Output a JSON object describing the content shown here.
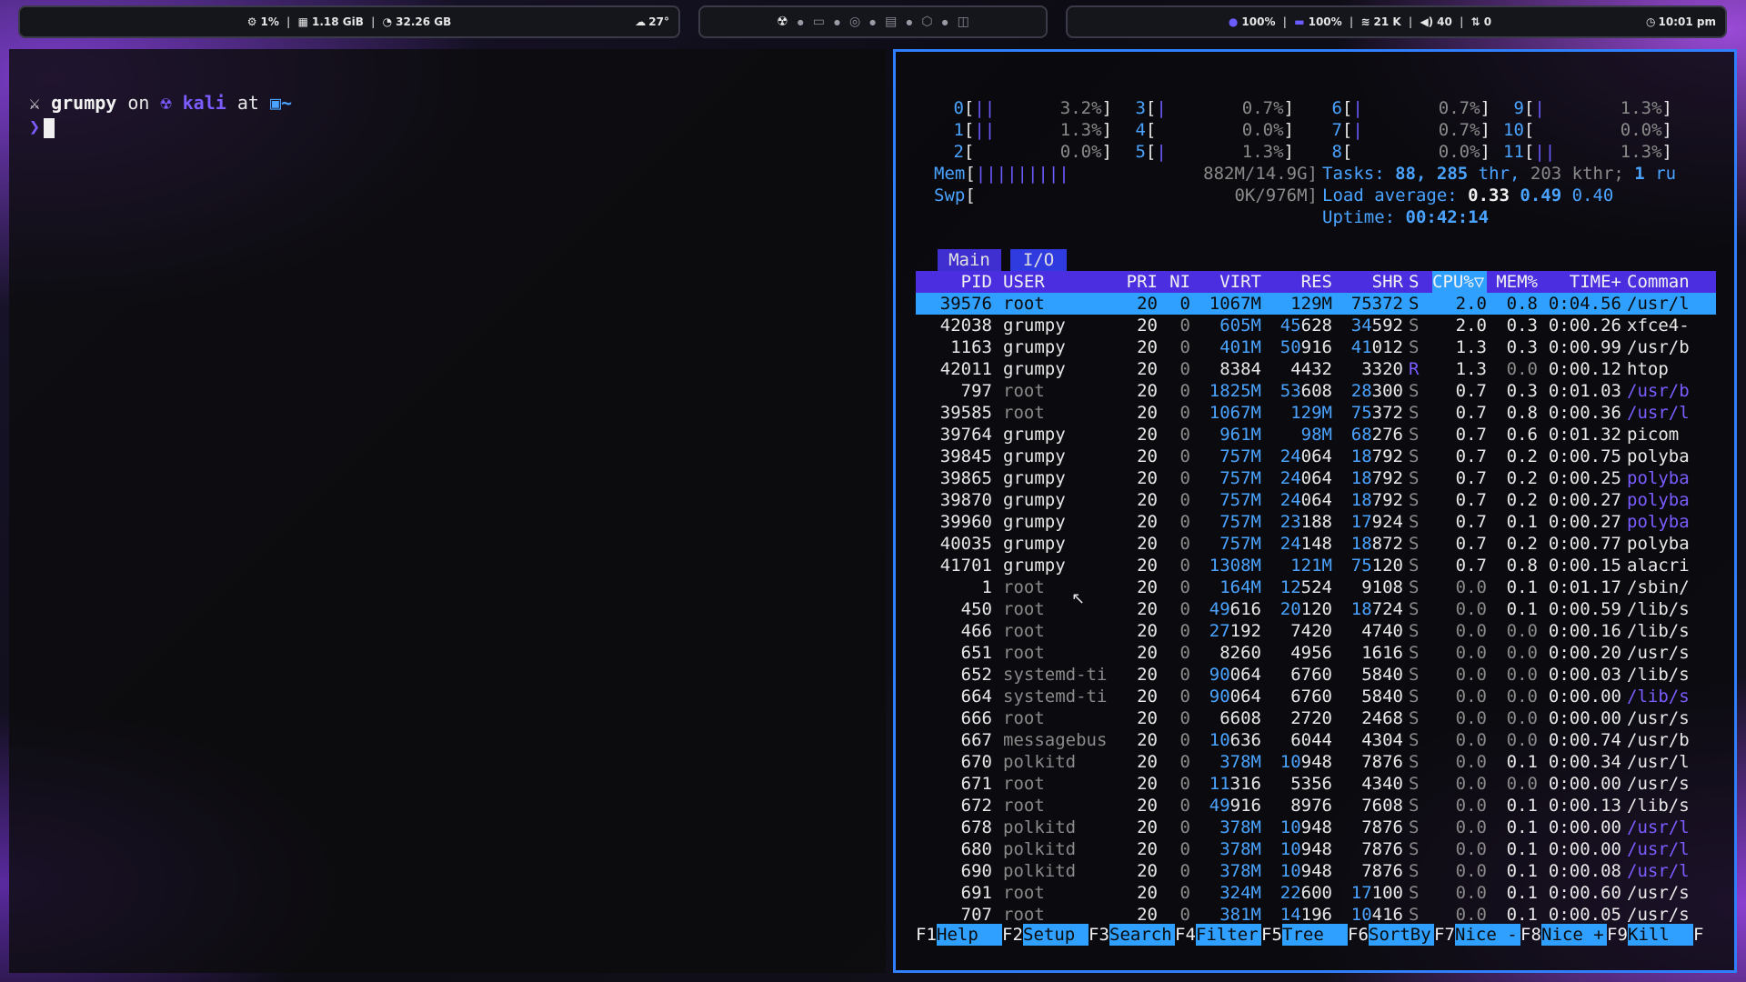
{
  "topbar": {
    "left": {
      "cpu": "1%",
      "ram": "1.18 GiB",
      "disk": "32.26 GB",
      "weather": "27°"
    },
    "workspaces": [
      "kali-icon",
      "folder-icon",
      "globe-icon",
      "chat-icon",
      "cube-icon",
      "gamepad-icon"
    ],
    "right": {
      "brightness": "100%",
      "battery": "100%",
      "network": "21 K",
      "volume": "40",
      "updates": "0",
      "clock": "10:01 pm"
    }
  },
  "left_terminal": {
    "user": "grumpy",
    "on": "on",
    "host": "kali",
    "at": "at",
    "dir": "~",
    "prompt_char": "❯"
  },
  "htop": {
    "cpus": [
      {
        "id": "0",
        "bar": "||",
        "pct": "3.2%]"
      },
      {
        "id": "1",
        "bar": "||",
        "pct": "1.3%]"
      },
      {
        "id": "2",
        "bar": "",
        "pct": "0.0%]"
      },
      {
        "id": "3",
        "bar": "|",
        "pct": "0.7%]"
      },
      {
        "id": "4",
        "bar": "",
        "pct": "0.0%]"
      },
      {
        "id": "5",
        "bar": "|",
        "pct": "1.3%]"
      },
      {
        "id": "6",
        "bar": "|",
        "pct": "0.7%]"
      },
      {
        "id": "7",
        "bar": "|",
        "pct": "0.7%]"
      },
      {
        "id": "8",
        "bar": "",
        "pct": "0.0%]"
      },
      {
        "id": "9",
        "bar": "|",
        "pct": "1.3%]"
      },
      {
        "id": "10",
        "bar": "",
        "pct": "0.0%]"
      },
      {
        "id": "11",
        "bar": "||",
        "pct": "1.3%]"
      }
    ],
    "mem": {
      "label": "Mem",
      "bar": "|||||||||",
      "value": "882M/14.9G]"
    },
    "swp": {
      "label": "Swp",
      "bar": "",
      "value": "0K/976M]"
    },
    "tasks": {
      "label": "Tasks:",
      "count": "88,",
      "thr": "285",
      "thr_label": "thr,",
      "kthr": "203 kthr;",
      "running": "1",
      "running_label": "ru"
    },
    "load": {
      "label": "Load average:",
      "one": "0.33",
      "five": "0.49",
      "fifteen": "0.40"
    },
    "uptime": {
      "label": "Uptime:",
      "value": "00:42:14"
    },
    "tabs": [
      "Main",
      "I/O"
    ],
    "columns": [
      "PID",
      "USER",
      "PRI",
      "NI",
      "VIRT",
      "RES",
      "SHR",
      "S",
      "CPU%▽",
      "MEM%",
      "TIME+",
      "Comman"
    ],
    "rows": [
      [
        "39576",
        "root",
        "20",
        "0",
        "1067M",
        "129M",
        "75372",
        "S",
        "2.0",
        "0.8",
        "0:04.56",
        "/usr/l"
      ],
      [
        "42038",
        "grumpy",
        "20",
        "0",
        "605M",
        "45628",
        "34592",
        "S",
        "2.0",
        "0.3",
        "0:00.26",
        "xfce4-"
      ],
      [
        "1163",
        "grumpy",
        "20",
        "0",
        "401M",
        "50916",
        "41012",
        "S",
        "1.3",
        "0.3",
        "0:00.99",
        "/usr/b"
      ],
      [
        "42011",
        "grumpy",
        "20",
        "0",
        "8384",
        "4432",
        "3320",
        "R",
        "1.3",
        "0.0",
        "0:00.12",
        "htop"
      ],
      [
        "797",
        "root",
        "20",
        "0",
        "1825M",
        "53608",
        "28300",
        "S",
        "0.7",
        "0.3",
        "0:01.03",
        "/usr/b"
      ],
      [
        "39585",
        "root",
        "20",
        "0",
        "1067M",
        "129M",
        "75372",
        "S",
        "0.7",
        "0.8",
        "0:00.36",
        "/usr/l"
      ],
      [
        "39764",
        "grumpy",
        "20",
        "0",
        "961M",
        "98M",
        "68276",
        "S",
        "0.7",
        "0.6",
        "0:01.32",
        "picom"
      ],
      [
        "39845",
        "grumpy",
        "20",
        "0",
        "757M",
        "24064",
        "18792",
        "S",
        "0.7",
        "0.2",
        "0:00.75",
        "polyba"
      ],
      [
        "39865",
        "grumpy",
        "20",
        "0",
        "757M",
        "24064",
        "18792",
        "S",
        "0.7",
        "0.2",
        "0:00.25",
        "polyba"
      ],
      [
        "39870",
        "grumpy",
        "20",
        "0",
        "757M",
        "24064",
        "18792",
        "S",
        "0.7",
        "0.2",
        "0:00.27",
        "polyba"
      ],
      [
        "39960",
        "grumpy",
        "20",
        "0",
        "757M",
        "23188",
        "17924",
        "S",
        "0.7",
        "0.1",
        "0:00.27",
        "polyba"
      ],
      [
        "40035",
        "grumpy",
        "20",
        "0",
        "757M",
        "24148",
        "18872",
        "S",
        "0.7",
        "0.2",
        "0:00.77",
        "polyba"
      ],
      [
        "41701",
        "grumpy",
        "20",
        "0",
        "1308M",
        "121M",
        "75120",
        "S",
        "0.7",
        "0.8",
        "0:00.15",
        "alacri"
      ],
      [
        "1",
        "root",
        "20",
        "0",
        "164M",
        "12524",
        "9108",
        "S",
        "0.0",
        "0.1",
        "0:01.17",
        "/sbin/"
      ],
      [
        "450",
        "root",
        "20",
        "0",
        "49616",
        "20120",
        "18724",
        "S",
        "0.0",
        "0.1",
        "0:00.59",
        "/lib/s"
      ],
      [
        "466",
        "root",
        "20",
        "0",
        "27192",
        "7420",
        "4740",
        "S",
        "0.0",
        "0.0",
        "0:00.16",
        "/lib/s"
      ],
      [
        "651",
        "root",
        "20",
        "0",
        "8260",
        "4956",
        "1616",
        "S",
        "0.0",
        "0.0",
        "0:00.20",
        "/usr/s"
      ],
      [
        "652",
        "systemd-ti",
        "20",
        "0",
        "90064",
        "6760",
        "5840",
        "S",
        "0.0",
        "0.0",
        "0:00.03",
        "/lib/s"
      ],
      [
        "664",
        "systemd-ti",
        "20",
        "0",
        "90064",
        "6760",
        "5840",
        "S",
        "0.0",
        "0.0",
        "0:00.00",
        "/lib/s"
      ],
      [
        "666",
        "root",
        "20",
        "0",
        "6608",
        "2720",
        "2468",
        "S",
        "0.0",
        "0.0",
        "0:00.00",
        "/usr/s"
      ],
      [
        "667",
        "messagebus",
        "20",
        "0",
        "10636",
        "6044",
        "4304",
        "S",
        "0.0",
        "0.0",
        "0:00.74",
        "/usr/b"
      ],
      [
        "670",
        "polkitd",
        "20",
        "0",
        "378M",
        "10948",
        "7876",
        "S",
        "0.0",
        "0.1",
        "0:00.34",
        "/usr/l"
      ],
      [
        "671",
        "root",
        "20",
        "0",
        "11316",
        "5356",
        "4340",
        "S",
        "0.0",
        "0.0",
        "0:00.00",
        "/usr/s"
      ],
      [
        "672",
        "root",
        "20",
        "0",
        "49916",
        "8976",
        "7608",
        "S",
        "0.0",
        "0.1",
        "0:00.13",
        "/lib/s"
      ],
      [
        "678",
        "polkitd",
        "20",
        "0",
        "378M",
        "10948",
        "7876",
        "S",
        "0.0",
        "0.1",
        "0:00.00",
        "/usr/l"
      ],
      [
        "680",
        "polkitd",
        "20",
        "0",
        "378M",
        "10948",
        "7876",
        "S",
        "0.0",
        "0.1",
        "0:00.00",
        "/usr/l"
      ],
      [
        "690",
        "polkitd",
        "20",
        "0",
        "378M",
        "10948",
        "7876",
        "S",
        "0.0",
        "0.1",
        "0:00.08",
        "/usr/l"
      ],
      [
        "691",
        "root",
        "20",
        "0",
        "324M",
        "22600",
        "17100",
        "S",
        "0.0",
        "0.1",
        "0:00.60",
        "/usr/s"
      ],
      [
        "707",
        "root",
        "20",
        "0",
        "381M",
        "14196",
        "10416",
        "S",
        "0.0",
        "0.1",
        "0:00.05",
        "/usr/s"
      ]
    ],
    "fkeys": [
      {
        "key": "F1",
        "label": "Help  "
      },
      {
        "key": "F2",
        "label": "Setup "
      },
      {
        "key": "F3",
        "label": "Search"
      },
      {
        "key": "F4",
        "label": "Filter"
      },
      {
        "key": "F5",
        "label": "Tree  "
      },
      {
        "key": "F6",
        "label": "SortBy"
      },
      {
        "key": "F7",
        "label": "Nice -"
      },
      {
        "key": "F8",
        "label": "Nice +"
      },
      {
        "key": "F9",
        "label": "Kill  "
      },
      {
        "key": "F",
        "label": ""
      }
    ],
    "colors": {
      "selected_row": "#2fa0ff",
      "header": "#4b2ee0",
      "accent": "#4aa3ff",
      "purple": "#7b5cff",
      "dim": "#8a8a8a"
    }
  }
}
